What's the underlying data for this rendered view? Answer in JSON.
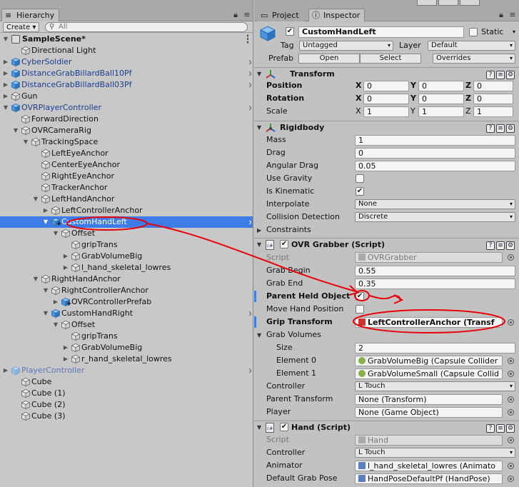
{
  "hierarchy": {
    "tab_label": "Hierarchy",
    "create_label": "Create ▾",
    "search_placeholder": "All",
    "scene_name": "SampleScene*",
    "items": [
      {
        "label": "Directional Light"
      },
      {
        "label": "CyberSoldier"
      },
      {
        "label": "DistanceGrabBillardBall10Pf"
      },
      {
        "label": "DistanceGrabBillardBall03Pf"
      },
      {
        "label": "Gun"
      },
      {
        "label": "OVRPlayerController"
      },
      {
        "label": "ForwardDirection"
      },
      {
        "label": "OVRCameraRig"
      },
      {
        "label": "TrackingSpace"
      },
      {
        "label": "LeftEyeAnchor"
      },
      {
        "label": "CenterEyeAnchor"
      },
      {
        "label": "RightEyeAnchor"
      },
      {
        "label": "TrackerAnchor"
      },
      {
        "label": "LeftHandAnchor"
      },
      {
        "label": "LeftControllerAnchor"
      },
      {
        "label": "CustomHandLeft"
      },
      {
        "label": "Offset"
      },
      {
        "label": "gripTrans"
      },
      {
        "label": "GrabVolumeBig"
      },
      {
        "label": "l_hand_skeletal_lowres"
      },
      {
        "label": "RightHandAnchor"
      },
      {
        "label": "RightControllerAnchor"
      },
      {
        "label": "OVRControllerPrefab"
      },
      {
        "label": "CustomHandRight"
      },
      {
        "label": "Offset"
      },
      {
        "label": "gripTrans"
      },
      {
        "label": "GrabVolumeBig"
      },
      {
        "label": "r_hand_skeletal_lowres"
      },
      {
        "label": "PlayerController"
      },
      {
        "label": "Cube"
      },
      {
        "label": "Cube (1)"
      },
      {
        "label": "Cube (2)"
      },
      {
        "label": "Cube (3)"
      }
    ]
  },
  "inspector": {
    "tab_project": "Project",
    "tab_inspector": "Inspector",
    "object_name": "CustomHandLeft",
    "static_label": "Static",
    "tag_label": "Tag",
    "tag_value": "Untagged",
    "layer_label": "Layer",
    "layer_value": "Default",
    "prefab_label": "Prefab",
    "open_label": "Open",
    "select_label": "Select",
    "overrides_label": "Overrides",
    "transform": {
      "title": "Transform",
      "position_label": "Position",
      "rotation_label": "Rotation",
      "scale_label": "Scale",
      "x": "X",
      "y": "Y",
      "z": "Z",
      "position": [
        "0",
        "0",
        "0"
      ],
      "rotation": [
        "0",
        "0",
        "0"
      ],
      "scale": [
        "1",
        "1",
        "1"
      ]
    },
    "rigidbody": {
      "title": "Rigidbody",
      "mass_label": "Mass",
      "mass": "1",
      "drag_label": "Drag",
      "drag": "0",
      "angular_drag_label": "Angular Drag",
      "angular_drag": "0.05",
      "use_gravity_label": "Use Gravity",
      "is_kinematic_label": "Is Kinematic",
      "interpolate_label": "Interpolate",
      "interpolate": "None",
      "collision_label": "Collision Detection",
      "collision": "Discrete",
      "constraints_label": "Constraints"
    },
    "grabber": {
      "title": "OVR Grabber (Script)",
      "script_label": "Script",
      "script": "OVRGrabber",
      "grab_begin_label": "Grab Begin",
      "grab_begin": "0.55",
      "grab_end_label": "Grab End",
      "grab_end": "0.35",
      "parent_held_label": "Parent Held Object",
      "move_hand_label": "Move Hand Position",
      "grip_transform_label": "Grip Transform",
      "grip_transform": "LeftControllerAnchor (Transf",
      "grab_volumes_label": "Grab Volumes",
      "size_label": "Size",
      "size": "2",
      "element0_label": "Element 0",
      "element0": "GrabVolumeBig (Capsule Collider",
      "element1_label": "Element 1",
      "element1": "GrabVolumeSmall (Capsule Collid",
      "controller_label": "Controller",
      "controller": "L Touch",
      "parent_transform_label": "Parent Transform",
      "parent_transform": "None (Transform)",
      "player_label": "Player",
      "player": "None (Game Object)"
    },
    "hand": {
      "title": "Hand (Script)",
      "script_label": "Script",
      "script": "Hand",
      "controller_label": "Controller",
      "controller": "L Touch",
      "animator_label": "Animator",
      "animator": "l_hand_skeletal_lowres (Animato",
      "grab_pose_label": "Default Grab Pose",
      "grab_pose": "HandPoseDefaultPf (HandPose)"
    }
  },
  "colors": {
    "selection": "#3e7de7",
    "annotation": "#e8000b",
    "prefab_text": "#1a3d8f"
  }
}
